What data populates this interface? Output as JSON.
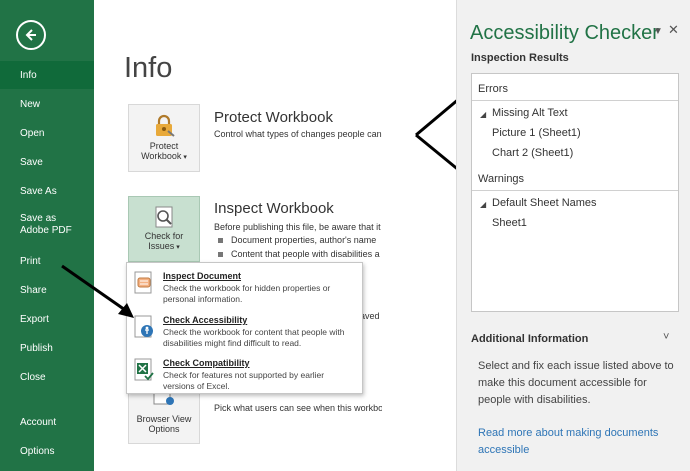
{
  "nav": {
    "back_icon": "back-arrow-icon",
    "items": [
      {
        "label": "Info"
      },
      {
        "label": "New"
      },
      {
        "label": "Open"
      },
      {
        "label": "Save"
      },
      {
        "label": "Save As"
      },
      {
        "label": "Save as Adobe PDF"
      },
      {
        "label": "Print"
      },
      {
        "label": "Share"
      },
      {
        "label": "Export"
      },
      {
        "label": "Publish"
      },
      {
        "label": "Close"
      },
      {
        "label": "Account"
      },
      {
        "label": "Options"
      }
    ]
  },
  "main": {
    "title": "Info",
    "protect": {
      "tile_line1": "Protect",
      "tile_line2": "Workbook",
      "heading": "Protect Workbook",
      "desc": "Control what types of changes people can"
    },
    "inspect": {
      "tile_line1": "Check for",
      "tile_line2": "Issues",
      "heading": "Inspect Workbook",
      "desc": "Before publishing this file, be aware that it",
      "bullets": [
        "Document properties, author's name",
        "Content that people with disabilities a"
      ]
    },
    "partial_saved": "aved",
    "browser": {
      "tile_line1": "Browser View",
      "tile_line2": "Options",
      "desc": "Pick what users can see when this workbo"
    },
    "dropdown": [
      {
        "title": "Inspect Document",
        "desc": "Check the workbook for hidden properties or personal information."
      },
      {
        "title": "Check Accessibility",
        "desc": "Check the workbook for content that people with disabilities might find difficult to read."
      },
      {
        "title": "Check Compatibility",
        "desc": "Check for features not supported by earlier versions of Excel."
      }
    ]
  },
  "pane": {
    "title": "Accessibility Checker",
    "inspection_results": "Inspection Results",
    "errors_label": "Errors",
    "error_group": "Missing Alt Text",
    "error_items": [
      "Picture 1 (Sheet1)",
      "Chart 2 (Sheet1)"
    ],
    "warnings_label": "Warnings",
    "warning_group": "Default Sheet Names",
    "warning_items": [
      "Sheet1"
    ],
    "additional_info": "Additional Information",
    "info_text": "Select and fix each issue listed above to make this document accessible for people with disabilities.",
    "link_text": "Read more about making documents accessible"
  },
  "colors": {
    "excel_green": "#217346",
    "link_blue": "#2e75b6"
  }
}
